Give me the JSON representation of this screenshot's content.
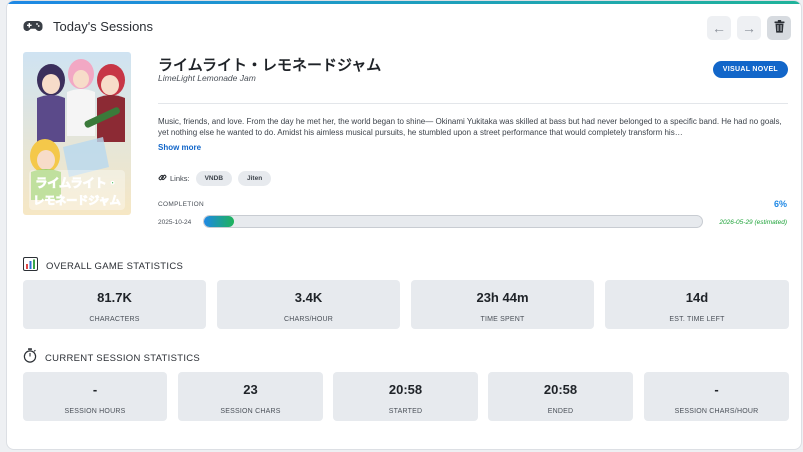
{
  "header": {
    "title": "Today's Sessions"
  },
  "nav": {
    "prev_icon": "←",
    "next_icon": "→",
    "delete_icon": "trash-icon"
  },
  "game": {
    "title": "ライムライト・レモネードジャム",
    "subtitle": "LimeLight Lemonade Jam",
    "type_badge": "VISUAL NOVEL",
    "description": "Music, friends, and love. From the day he met her, the world began to shine— Okinami Yukitaka was skilled at bass but had never belonged to a specific band. He had no goals, yet nothing else he wanted to do. Amidst his aimless musical pursuits, he stumbled upon a street performance that would completely transform his…",
    "show_more": "Show more",
    "links_label": "Links:",
    "links": [
      "VNDB",
      "Jiten"
    ]
  },
  "completion": {
    "label": "COMPLETION",
    "percent_text": "6%",
    "percent": 6,
    "start_date": "2025-10-24",
    "end_date": "2026-05-29 (estimated)"
  },
  "overall": {
    "heading": "OVERALL GAME STATISTICS",
    "stats": [
      {
        "value": "81.7K",
        "label": "CHARACTERS"
      },
      {
        "value": "3.4K",
        "label": "CHARS/HOUR"
      },
      {
        "value": "23h 44m",
        "label": "TIME SPENT"
      },
      {
        "value": "14d",
        "label": "EST. TIME LEFT"
      }
    ]
  },
  "session": {
    "heading": "CURRENT SESSION STATISTICS",
    "stats": [
      {
        "value": "-",
        "label": "SESSION HOURS"
      },
      {
        "value": "23",
        "label": "SESSION CHARS"
      },
      {
        "value": "20:58",
        "label": "STARTED"
      },
      {
        "value": "20:58",
        "label": "ENDED"
      },
      {
        "value": "-",
        "label": "SESSION CHARS/HOUR"
      }
    ]
  },
  "cover_logo_text": "ライムライト・レモネードジャム",
  "colors": {
    "accent": "#1266c9",
    "progress_start": "#1e88e5",
    "progress_end": "#1fb35a",
    "estimate": "#1fa33a"
  }
}
